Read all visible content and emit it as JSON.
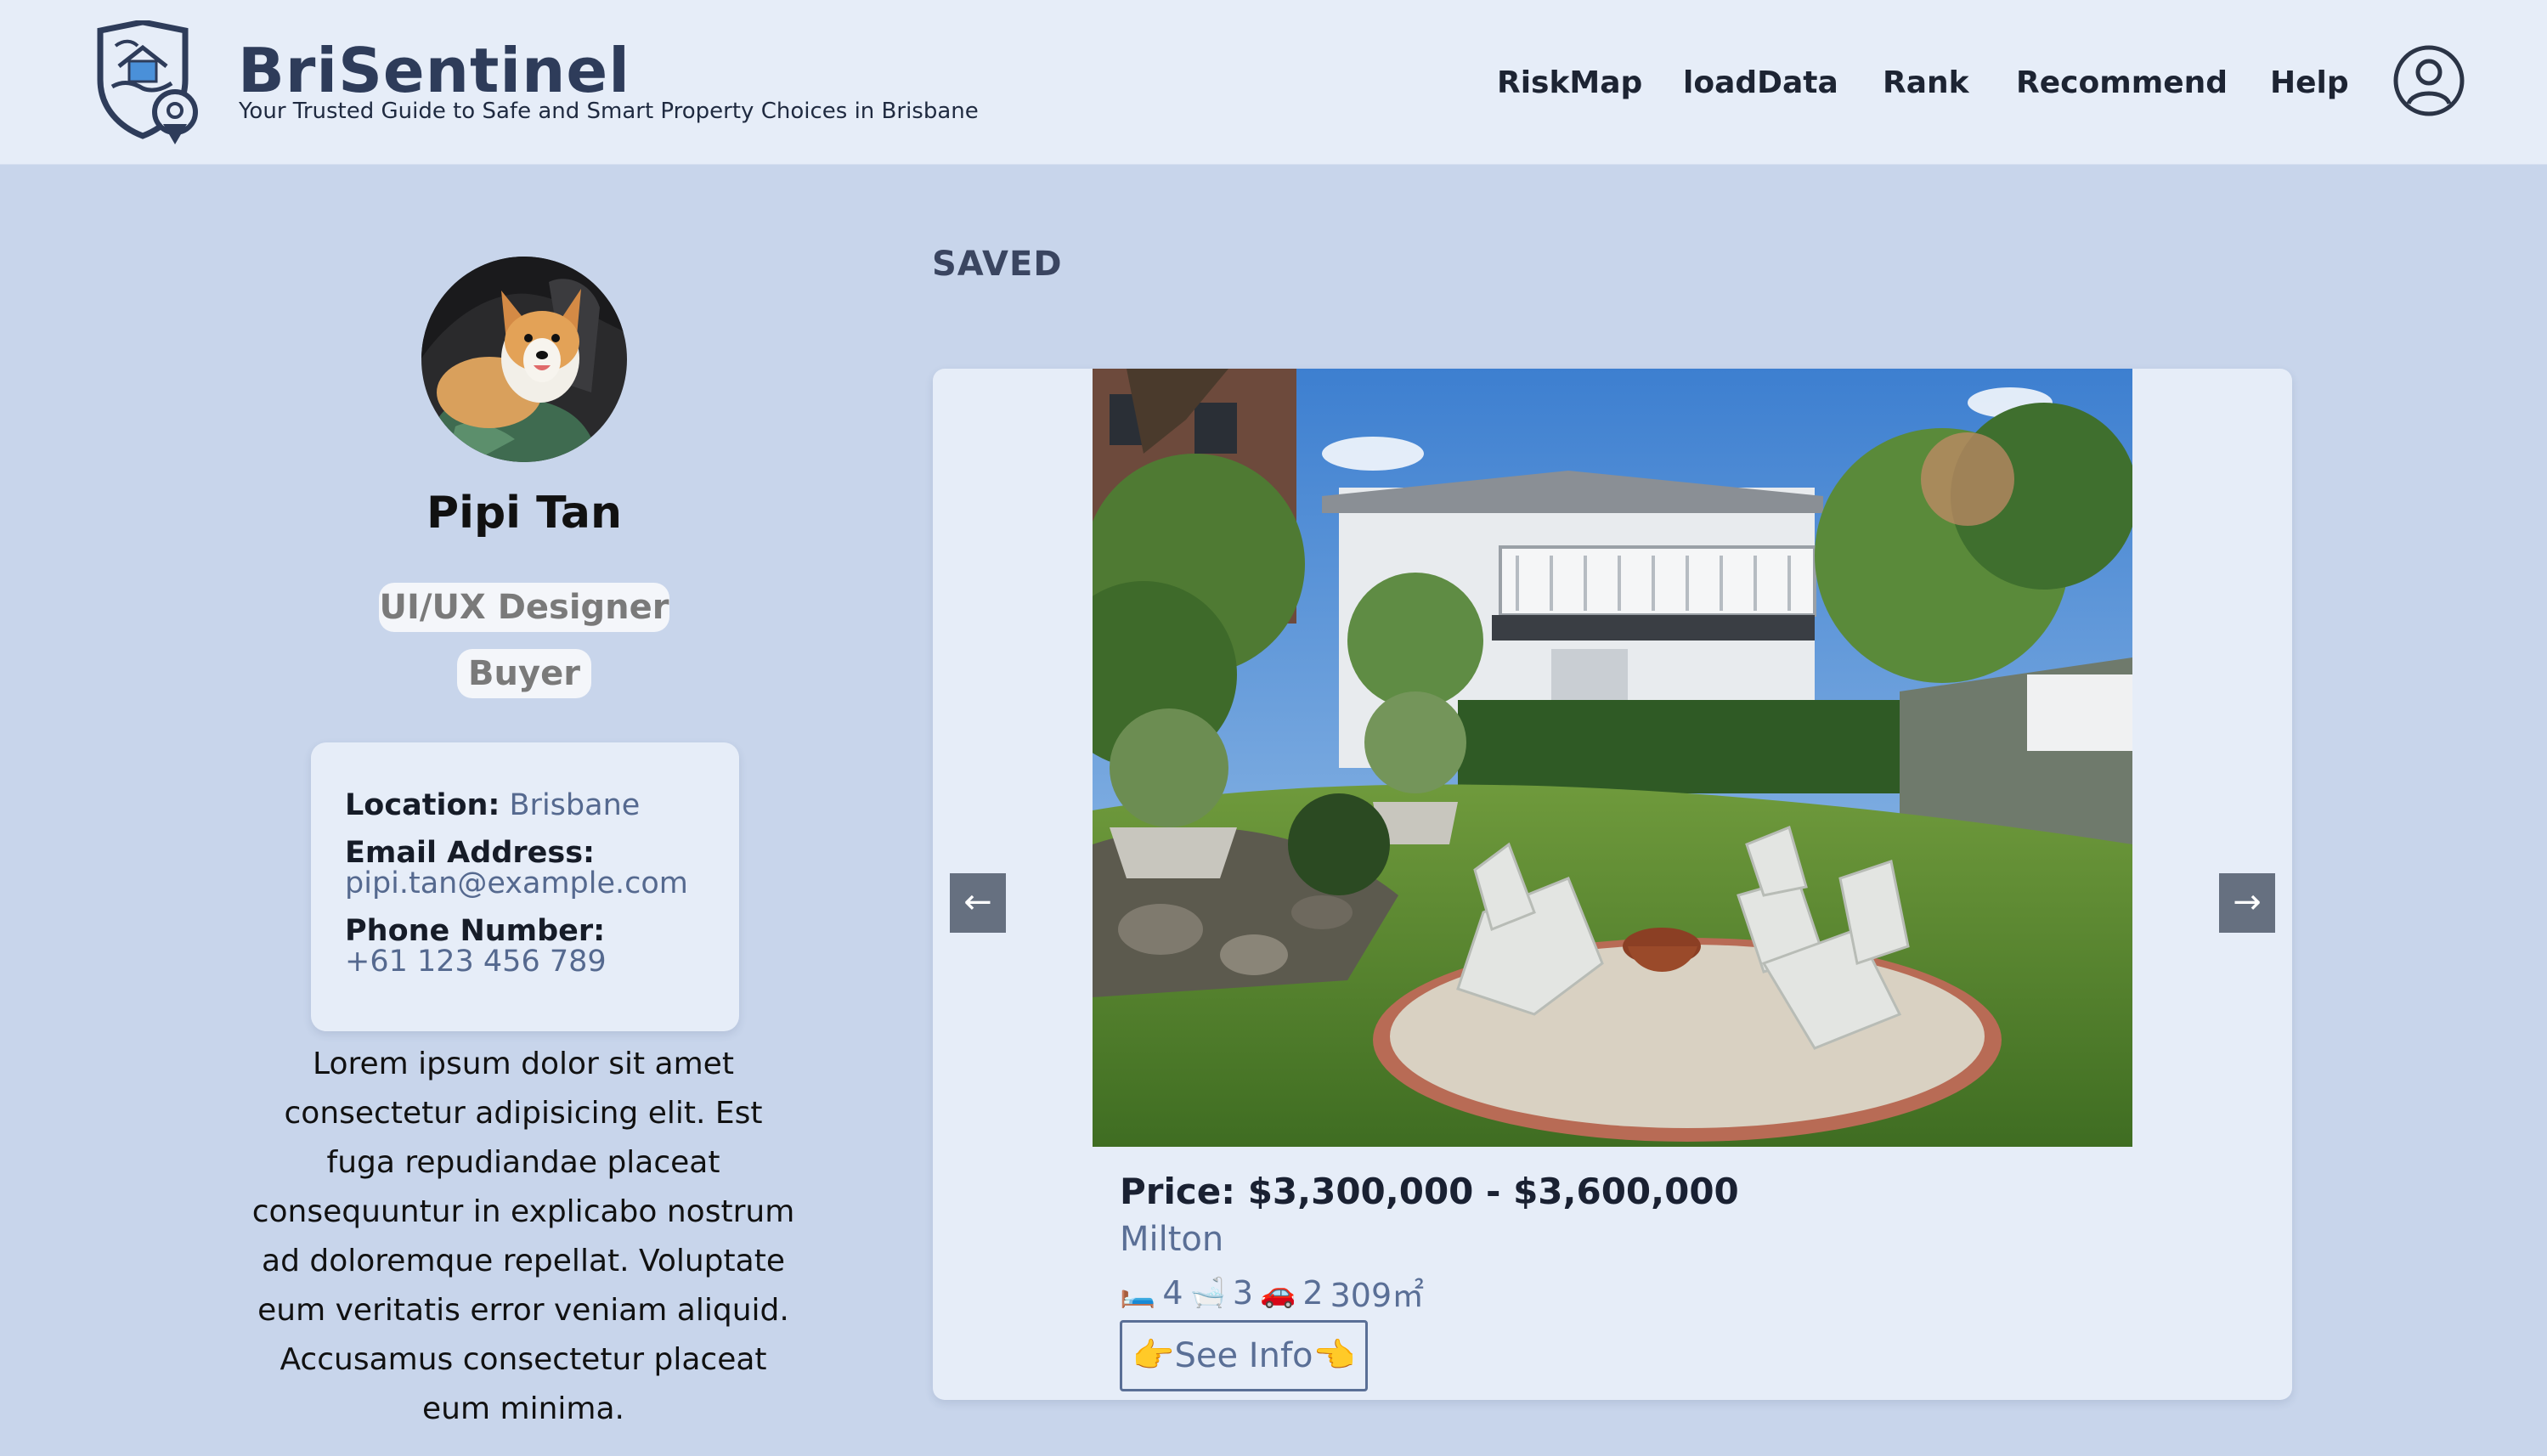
{
  "header": {
    "brand": "BriSentinel",
    "tagline": "Your Trusted Guide to Safe and Smart Property Choices in Brisbane",
    "nav": [
      "RiskMap",
      "loadData",
      "Rank",
      "Recommend",
      "Help"
    ],
    "user_icon": "user-circle-icon"
  },
  "profile": {
    "name": "Pipi Tan",
    "tags": [
      "UI/UX Designer",
      "Buyer"
    ],
    "location_label": "Location:",
    "location": "Brisbane",
    "email_label": "Email Address:",
    "email": "pipi.tan@example.com",
    "phone_label": "Phone Number:",
    "phone": "+61 123 456 789",
    "bio": "Lorem ipsum dolor sit amet consectetur adipisicing elit. Est fuga repudiandae placeat consequuntur in explicabo nostrum ad doloremque repellat. Voluptate eum veritatis error veniam aliquid. Accusamus consectetur placeat eum minima."
  },
  "saved": {
    "title": "SAVED",
    "prev_label": "←",
    "next_label": "→",
    "listing": {
      "price": "Price: $3,300,000 - $3,600,000",
      "suburb": "Milton",
      "bedrooms": "4",
      "bathrooms": "3",
      "parking": "2",
      "land_area": "309㎡",
      "see_info_label": "👉See Info👈"
    }
  },
  "colors": {
    "page_bg": "#c8d5eb",
    "header_bg": "#e6edf8",
    "accent_text": "#5a6f96",
    "arrow_bg": "#667080"
  }
}
